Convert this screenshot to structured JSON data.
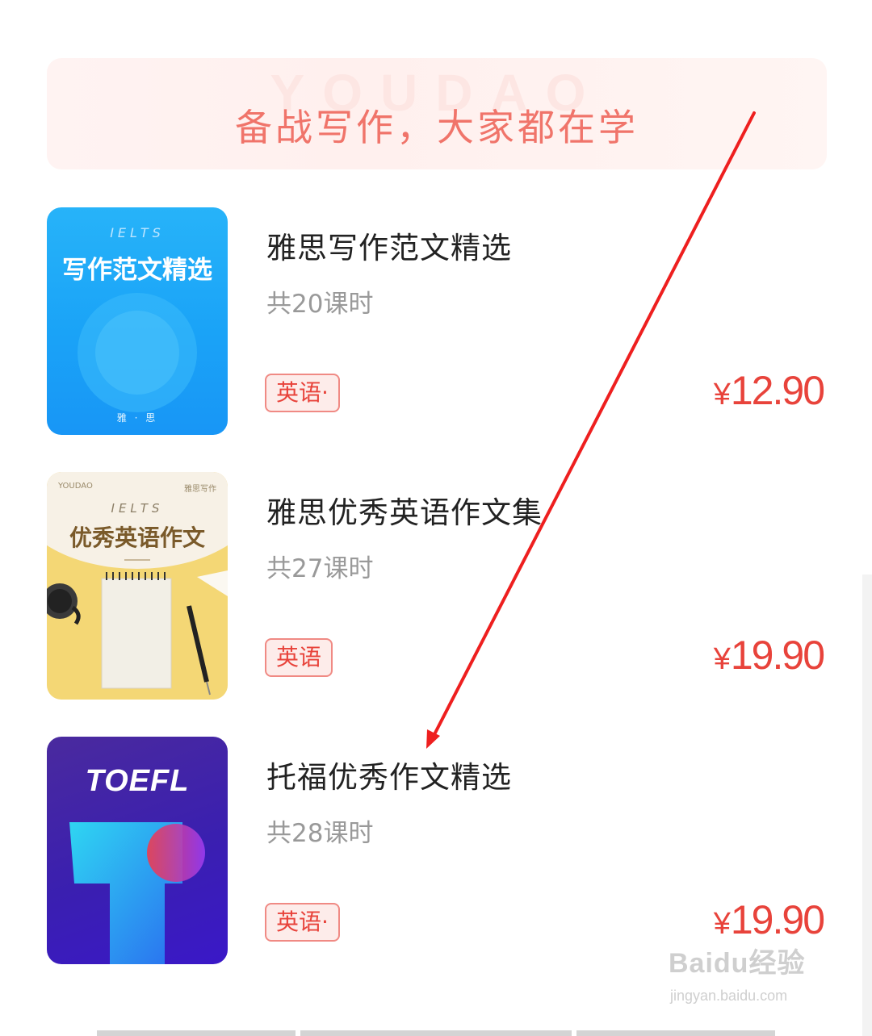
{
  "banner": {
    "watermark": "YOUDAO",
    "title": "备战写作，大家都在学"
  },
  "courses": [
    {
      "title": "雅思写作范文精选",
      "lessons": "共20课时",
      "tag": "英语·",
      "price_symbol": "¥",
      "price": "12.90",
      "cover": {
        "top": "IELTS",
        "title": "写作范文精选",
        "footer": "雅 · 思",
        "color": "#1aa3f7"
      }
    },
    {
      "title": "雅思优秀英语作文集",
      "lessons": "共27课时",
      "tag": "英语",
      "price_symbol": "¥",
      "price": "19.90",
      "cover": {
        "brand": "YOUDAO",
        "corner": "雅思写作",
        "top": "IELTS",
        "title": "优秀英语作文",
        "color": "#f4d775"
      }
    },
    {
      "title": "托福优秀作文精选",
      "lessons": "共28课时",
      "tag": "英语·",
      "price_symbol": "¥",
      "price": "19.90",
      "cover": {
        "title": "TOEFL",
        "color": "#3a1fb0"
      }
    }
  ],
  "watermark": {
    "brand": "Baidu经验",
    "url": "jingyan.baidu.com"
  },
  "colors": {
    "accent": "#e8433b",
    "annotation_arrow": "#ee1f1f"
  }
}
